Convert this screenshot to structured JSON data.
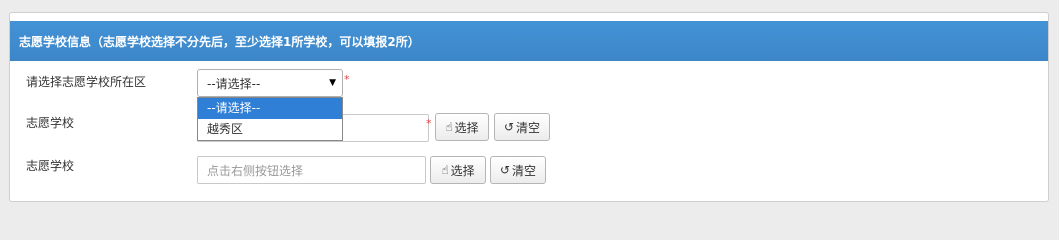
{
  "panel": {
    "title": "志愿学校信息（志愿学校选择不分先后，至少选择1所学校，可以填报2所）"
  },
  "district": {
    "label": "请选择志愿学校所在区",
    "selected": "--请选择--",
    "required_mark": "*",
    "options": [
      "--请选择--",
      "越秀区"
    ]
  },
  "school1": {
    "label": "志愿学校",
    "value": "",
    "required_mark": "*",
    "select_label": "选择",
    "clear_label": "清空"
  },
  "school2": {
    "label": "志愿学校",
    "placeholder": "点击右侧按钮选择",
    "select_label": "选择",
    "clear_label": "清空"
  },
  "icons": {
    "select_button_icon": "pointer-hand-icon",
    "clear_button_icon": "undo-icon",
    "dropdown_caret": "caret-down-icon"
  },
  "colors": {
    "header": "#3c86c8",
    "dropdown_highlight": "#2f7fd7",
    "required": "#e04040"
  }
}
